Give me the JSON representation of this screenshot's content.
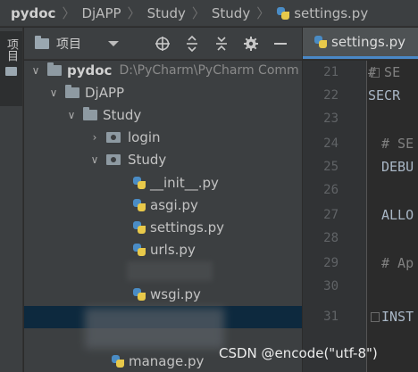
{
  "breadcrumb": {
    "items": [
      "pydoc",
      "DjAPP",
      "Study",
      "Study",
      "settings.py"
    ]
  },
  "left_strip": {
    "tab_label": "项目"
  },
  "project_toolbar": {
    "view_label": "项目"
  },
  "editor_tab": {
    "label": "settings.py"
  },
  "tree": {
    "root_name": "pydoc",
    "root_path": "D:\\PyCharm\\PyCharm Comm",
    "djapp": "DjAPP",
    "study": "Study",
    "login": "login",
    "study_inner": "Study",
    "files": [
      "__init__.py",
      "asgi.py",
      "settings.py",
      "urls.py",
      "wsgi.py"
    ],
    "manage": "manage.py"
  },
  "editor": {
    "line_numbers": [
      "21",
      "22",
      "23",
      "24",
      "25",
      "26",
      "27",
      "28",
      "29",
      "30",
      "31"
    ],
    "lines": [
      "# SE",
      "SECR",
      "",
      "# SE",
      "DEBU",
      "",
      "ALLO",
      "",
      "# Ap",
      "",
      "INST"
    ]
  },
  "watermark": "CSDN @encode(\"utf-8\")",
  "colors": {
    "accent": "#4a88c7",
    "selection": "#0d293e",
    "python_blue": "#4a8cc5",
    "python_yellow": "#e8c94a"
  }
}
